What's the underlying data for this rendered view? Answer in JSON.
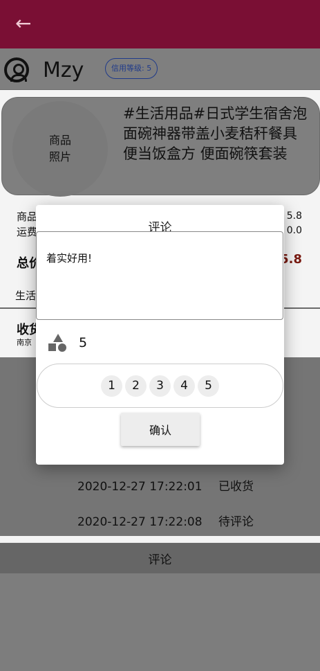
{
  "appbar": {
    "back_icon": "arrow-left-icon"
  },
  "user": {
    "name": "Mzy",
    "credit_badge": "信用等级: 5"
  },
  "product": {
    "photo_label": "商品\n照片",
    "name": "#生活用品#日式学生宿舍泡面碗神器带盖小麦秸秆餐具便当饭盒方 便面碗筷套装"
  },
  "price": {
    "goods_label": "商品",
    "shipping_label": "运费",
    "goods_value": "5.8",
    "shipping_value": "0.0",
    "total_label": "总价",
    "total_value": "5.8"
  },
  "category": "生活",
  "address": {
    "label": "收货",
    "value": "南京"
  },
  "order": {
    "times": [
      {
        "time": "2020-12-27 17:22:01",
        "status": "已收货"
      },
      {
        "time": "2020-12-27 17:22:08",
        "status": "待评论"
      }
    ]
  },
  "review_bar_label": "评论",
  "dialog": {
    "title": "评论",
    "comment_text": "着实好用!",
    "rating_icon": "shapes-icon",
    "rating_value": "5",
    "rating_options": [
      "1",
      "2",
      "3",
      "4",
      "5"
    ],
    "confirm_label": "确认"
  },
  "colors": {
    "appbar": "#7a0f34",
    "accent_price": "#c0392b"
  }
}
